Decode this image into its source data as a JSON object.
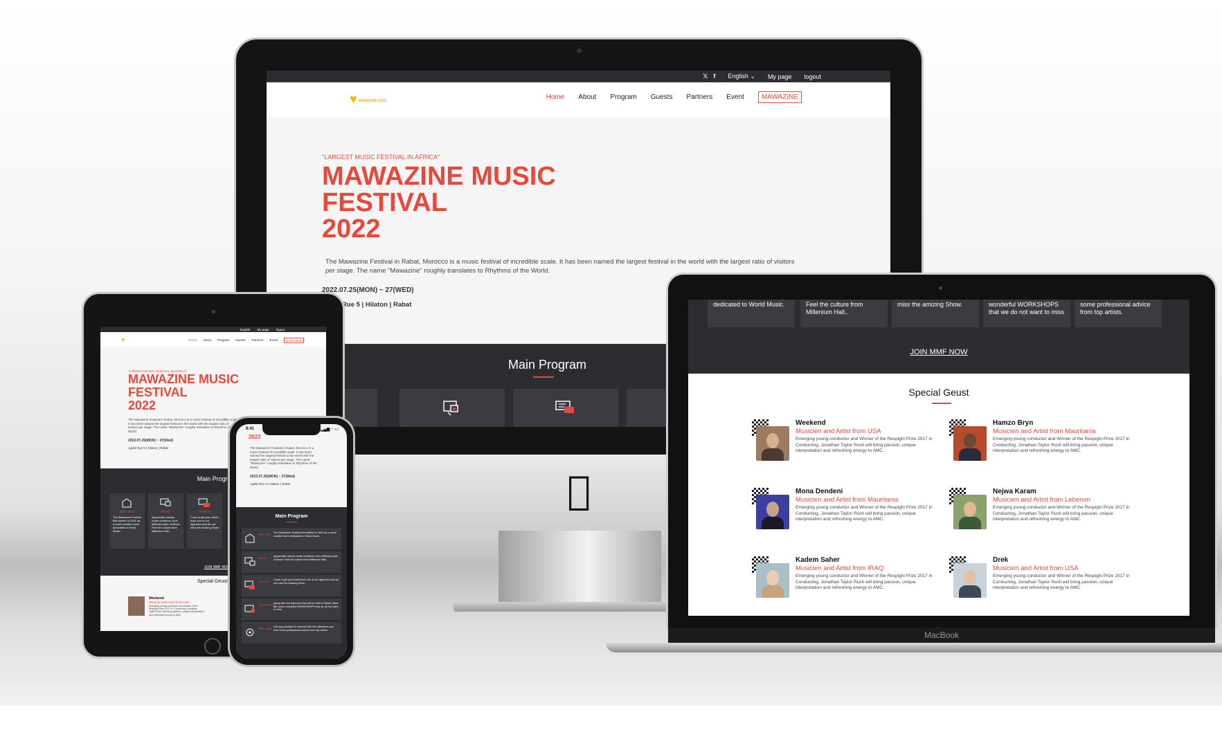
{
  "desktop": {
    "topbar": {
      "twitter": "𝕏",
      "facebook": "f",
      "language": "English  ⌄",
      "my_page": "My page",
      "logout": "logout"
    },
    "logo": {
      "heart": "♥",
      "text": "MAWAZINE 2022"
    },
    "nav": [
      "Home",
      "About",
      "Program",
      "Guests",
      "Partners",
      "Event",
      "MAWAZINE"
    ],
    "hero": {
      "tag": "\"LARGEST MUSIC FESTIVAL IN AFRICA\"",
      "title_line1": "MAWAZINE MUSIC",
      "title_line2": "FESTIVAL",
      "title_line3": "2022",
      "description": "The Mawazine Festival in Rabat, Morocco is a music festival of incredible scale. It has been named the largest festival in the world with the largest ratio of visitors per stage. The name \"Mawazine\" roughly translates to Rhythms of the World.",
      "date": "2022.07.25(MON) ~ 27(WED)",
      "venue": "Agdal Rue 5 | Hilaton | Rabat"
    },
    "main_program_title": "Main Program"
  },
  "laptop": {
    "cards": [
      "dedicated to World Music.",
      "Feel the culture from Millenium Hall..",
      "miss the amizing Show.",
      "wonderful WORKSHOPS that we do not want to miss",
      "some professional advice from top artists."
    ],
    "join": "JOIN MMF NOW",
    "special_guest_title": "Special Geust",
    "bio": "Emerging young conductor and Winner of the Respighi Prize 2017 in Conducting, Jonathan Taylor Rush will bring passion, unique interpretation and refreshing energy to AMC.",
    "guests": [
      {
        "name": "Weekend",
        "role": "Musicien and Artist from USA"
      },
      {
        "name": "Hamzo Bryn",
        "role": "Musicien and Artist from Mauritania"
      },
      {
        "name": "Mona Dendeni",
        "role": "Musicien and Artist from Mauritania"
      },
      {
        "name": "Nejwa Karam",
        "role": "Musicien and Artist from Lebenon"
      },
      {
        "name": "Kadem Saher",
        "role": "Musicien and Artist from IRAQ"
      },
      {
        "name": "Drek",
        "role": "Musicien and Artist from USA"
      }
    ],
    "brand": "MacBook"
  },
  "tablet": {
    "topbar": {
      "language": "English",
      "my_page": "My page",
      "logout": "logout"
    },
    "nav": [
      "Home",
      "About",
      "Program",
      "Guests",
      "Partners",
      "Event",
      "MAWAZINE"
    ],
    "hero": {
      "tag": "\"LARGEST MUSIC FESTIVAL IN AFRICA\"",
      "title_line1": "MAWAZINE MUSIC",
      "title_line2": "FESTIVAL",
      "title_line3": "2022",
      "description": "The Mawazine Festival in Rabat, Morocco is a music festival of incredible scale. It has been named the largest festival in the world with the largest ratio of visitors per stage. The name \"Mawazine\" roughly translates to Rhythms of the World.",
      "date": "2022.07.25(MON) ~ 27(Wed)",
      "venue": "Agdal Rue 5 | Hilaton | Rabat"
    },
    "main_program_title": "Main Program",
    "cards": [
      {
        "label": "MMF 2022",
        "text": "The Mawazine Festival first started in 2001 as a much smaller event dedicated to World Music."
      },
      {
        "label": "MUSIC",
        "text": "Appreciate various music creations, from different parts of Africa. Feel the culture from Millenium Hall.."
      },
      {
        "label": "TICKETS",
        "text": "Come a get your ticket from one of our agencies and do not miss the amizing Show."
      }
    ],
    "join": "JOIN MMF NOW",
    "special_guest_title": "Special Geust",
    "guest": {
      "name": "Weekend",
      "role": "Musicien and Artist from USA"
    },
    "bio": "Emerging young conductor and Winner of the Respighi Prize 2017 in Conducting, Jonathan Taylor Rush will bring passion, unique interpretation and refreshing energy to AMC."
  },
  "phone": {
    "time": "9:41",
    "status": "▂▄▆ ◔ ▭",
    "hero_tail": "2022",
    "description": "The Mawazine Festival in Rabat, Morocco is a music festival of incredible scale. It has been named the largest festival in the world with the largest ratio of visitors per stage. The name \"Mawazine\" roughly translates to Rhythms of the World.",
    "date": "2022.07.25(MON) ~ 27(Wed)",
    "venue": "Agdal Rue 5 | Hilaton | Rabat",
    "main_program_title": "Main Program",
    "rows": [
      {
        "label": "MMF 2022",
        "text": "The Mawazine Festival first started in 2001 as a much smaller event dedicated to World Music."
      },
      {
        "label": "MUSIC",
        "text": "Appreciate various music creations, from different parts of Africa. Feel the culture from Millenium Hall.."
      },
      {
        "label": "TICKETS",
        "text": "Come a get your ticket from one of our agencies and do not miss the amizing Show."
      },
      {
        "label": "WORKSHOPS",
        "text": "Along with the big event that will be held in Rabat, there are some wonderful WORKSHOPS that we do not want to miss"
      },
      {
        "label": "MMF Ingila",
        "text": "Get opportunities to network with the attendees and hear some professional advice from top artists."
      }
    ]
  },
  "colors": {
    "accent": "#e8473a",
    "dark": "#2b2d31",
    "card": "#3a3c41",
    "logo": "#f2b705"
  }
}
